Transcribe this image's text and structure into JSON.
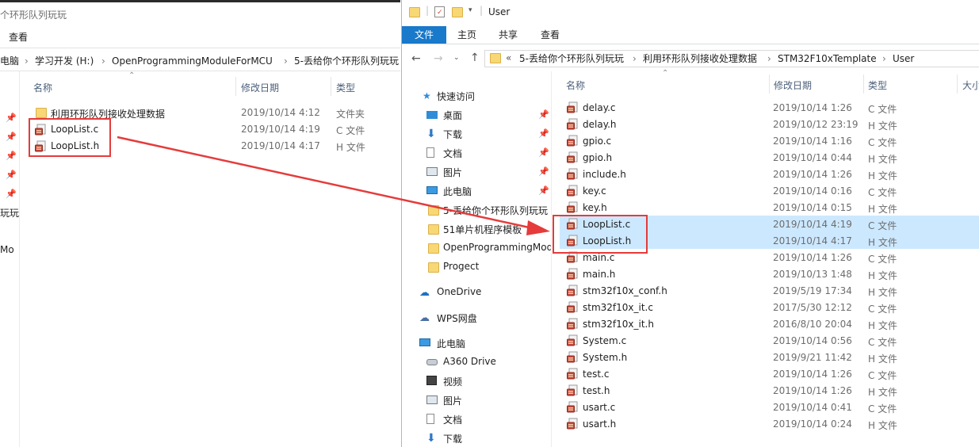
{
  "left": {
    "title": "个环形队列玩玩",
    "ribbon_view": "查看",
    "breadcrumb": [
      "电脑",
      "学习开发 (H:)",
      "OpenProgrammingModuleForMCU",
      "5-丢给你个环形队列玩玩"
    ],
    "columns": {
      "name": "名称",
      "date": "修改日期",
      "type": "类型"
    },
    "nav_fragments": [
      "玩玩",
      "Mo"
    ],
    "files": [
      {
        "name": "利用环形队列接收处理数据",
        "date": "2019/10/14 4:12",
        "type": "文件夹",
        "icon": "folder-icon"
      },
      {
        "name": "LoopList.c",
        "date": "2019/10/14 4:19",
        "type": "C 文件",
        "icon": "c-file-icon"
      },
      {
        "name": "LoopList.h",
        "date": "2019/10/14 4:17",
        "type": "H 文件",
        "icon": "h-file-icon"
      }
    ]
  },
  "right": {
    "title": "User",
    "ribbon_tabs": [
      "文件",
      "主页",
      "共享",
      "查看"
    ],
    "breadcrumb_prefix": "«",
    "breadcrumb": [
      "5-丢给你个环形队列玩玩",
      "利用环形队列接收处理数据",
      "STM32F10xTemplate",
      "User"
    ],
    "columns": {
      "name": "名称",
      "date": "修改日期",
      "type": "类型",
      "size": "大小"
    },
    "nav": {
      "quick_access": "快速访问",
      "quick_items": [
        "桌面",
        "下载",
        "文档",
        "图片",
        "此电脑",
        "5-丢给你个环形队列玩玩",
        "51单片机程序模板",
        "OpenProgrammingModuleForMCU",
        "Progect"
      ],
      "onedrive": "OneDrive",
      "wps": "WPS网盘",
      "this_pc": "此电脑",
      "pc_items": [
        "A360 Drive",
        "视频",
        "图片",
        "文档",
        "下载"
      ]
    },
    "files": [
      {
        "name": "delay.c",
        "date": "2019/10/14 1:26",
        "type": "C 文件"
      },
      {
        "name": "delay.h",
        "date": "2019/10/12 23:19",
        "type": "H 文件"
      },
      {
        "name": "gpio.c",
        "date": "2019/10/14 1:16",
        "type": "C 文件"
      },
      {
        "name": "gpio.h",
        "date": "2019/10/14 0:44",
        "type": "H 文件"
      },
      {
        "name": "include.h",
        "date": "2019/10/14 1:26",
        "type": "H 文件"
      },
      {
        "name": "key.c",
        "date": "2019/10/14 0:16",
        "type": "C 文件"
      },
      {
        "name": "key.h",
        "date": "2019/10/14 0:15",
        "type": "H 文件"
      },
      {
        "name": "LoopList.c",
        "date": "2019/10/14 4:19",
        "type": "C 文件"
      },
      {
        "name": "LoopList.h",
        "date": "2019/10/14 4:17",
        "type": "H 文件"
      },
      {
        "name": "main.c",
        "date": "2019/10/14 1:26",
        "type": "C 文件"
      },
      {
        "name": "main.h",
        "date": "2019/10/13 1:48",
        "type": "H 文件"
      },
      {
        "name": "stm32f10x_conf.h",
        "date": "2019/5/19 17:34",
        "type": "H 文件"
      },
      {
        "name": "stm32f10x_it.c",
        "date": "2017/5/30 12:12",
        "type": "C 文件"
      },
      {
        "name": "stm32f10x_it.h",
        "date": "2016/8/10 20:04",
        "type": "H 文件"
      },
      {
        "name": "System.c",
        "date": "2019/10/14 0:56",
        "type": "C 文件"
      },
      {
        "name": "System.h",
        "date": "2019/9/21 11:42",
        "type": "H 文件"
      },
      {
        "name": "test.c",
        "date": "2019/10/14 1:26",
        "type": "C 文件"
      },
      {
        "name": "test.h",
        "date": "2019/10/14 1:26",
        "type": "H 文件"
      },
      {
        "name": "usart.c",
        "date": "2019/10/14 0:41",
        "type": "C 文件"
      },
      {
        "name": "usart.h",
        "date": "2019/10/14 0:24",
        "type": "H 文件"
      }
    ]
  },
  "colors": {
    "ribbon_blue": "#1979ca",
    "selection": "#cce8ff",
    "annotation_red": "#e53b3b"
  }
}
